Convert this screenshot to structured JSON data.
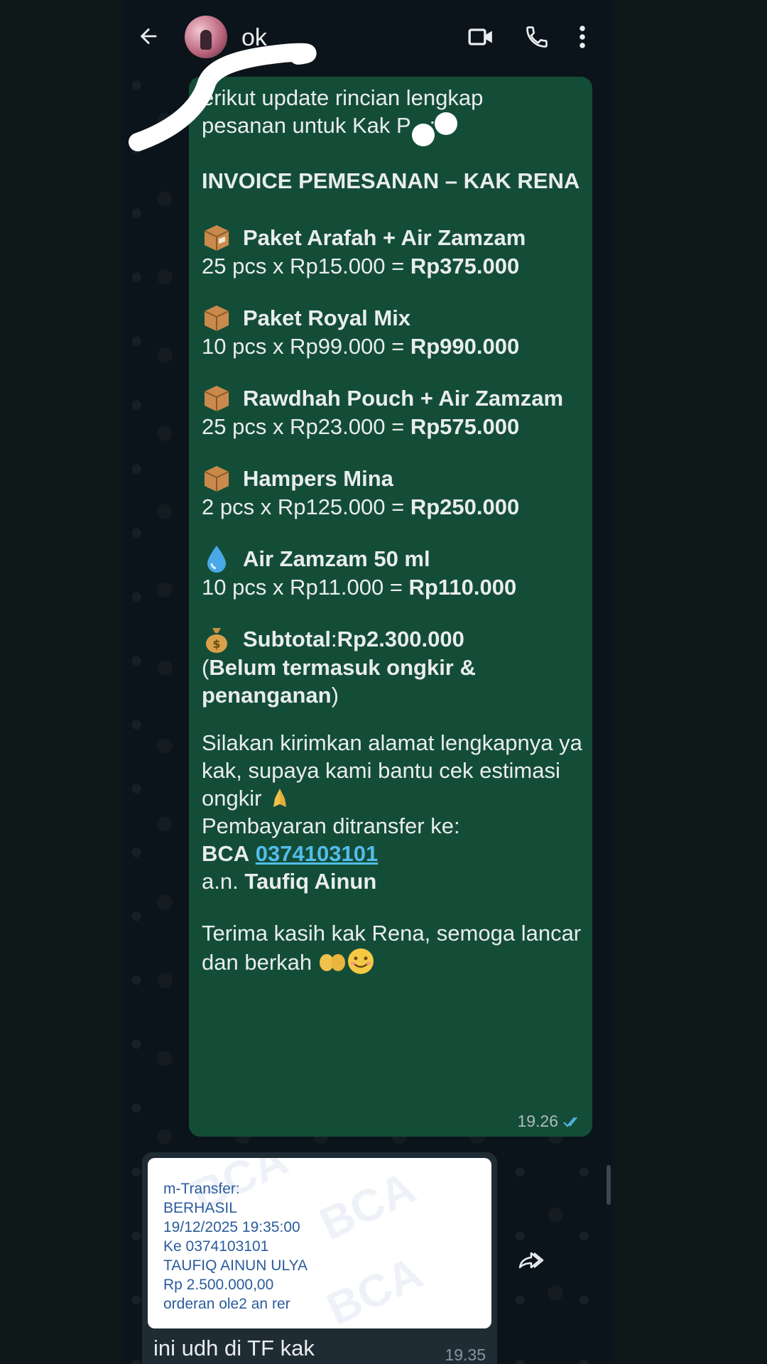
{
  "header": {
    "contact_name": "                  ok",
    "back_icon": "arrow-left-icon",
    "video_icon": "video-camera-icon",
    "call_icon": "phone-icon",
    "menu_icon": "more-vertical-icon"
  },
  "message_out": {
    "intro_line1": "erikut update rincian lengkap",
    "intro_line2": "pesanan untuk Kak P",
    "intro_line2_end": ":",
    "invoice_title": "INVOICE PEMESANAN – KAK RENA",
    "items": [
      {
        "icon": "package-emoji",
        "name": "Paket Arafah + Air Zamzam",
        "calc": "25 pcs x Rp15.000 = ",
        "total": "Rp375.000"
      },
      {
        "icon": "package-emoji",
        "name": "Paket Royal Mix",
        "calc": "10 pcs x Rp99.000 = ",
        "total": "Rp990.000"
      },
      {
        "icon": "package-emoji",
        "name": "Rawdhah Pouch + Air Zamzam",
        "calc": "25 pcs x Rp23.000 = ",
        "total": "Rp575.000"
      },
      {
        "icon": "package-emoji",
        "name": "Hampers Mina",
        "calc": "2 pcs x Rp125.000 = ",
        "total": "Rp250.000"
      },
      {
        "icon": "droplet-emoji",
        "name": "Air Zamzam 50 ml",
        "calc": "10 pcs x Rp11.000 = ",
        "total": "Rp110.000"
      }
    ],
    "subtotal_label": "Subtotal",
    "subtotal_sep": ": ",
    "subtotal_value": "Rp2.300.000",
    "note_open": "(",
    "note_bold": "Belum termasuk ongkir & penanganan",
    "note_close": ")",
    "request_text": "Silakan kirimkan alamat lengkapnya ya kak, supaya kami bantu cek estimasi ongkir",
    "payment_label": "Pembayaran ditransfer ke:",
    "bank_name": "BCA",
    "bank_account": "0374103101",
    "account_holder_prefix": "a.n. ",
    "account_holder": "Taufiq Ainun",
    "closing_text": "Terima kasih kak Rena, semoga lancar dan berkah",
    "time": "19.26",
    "status_icon": "double-check-read-icon"
  },
  "message_in": {
    "receipt_watermark": "BCA",
    "receipt_lines": [
      "m-Transfer:",
      "BERHASIL",
      "19/12/2025 19:35:00",
      "Ke 0374103101",
      "TAUFIQ AINUN ULYA",
      "Rp 2.500.000,00",
      "orderan ole2 an rer"
    ],
    "caption": "ini udh di TF kak",
    "time": "19.35"
  },
  "forward_icon": "forward-icon",
  "colors": {
    "bubble_out": "#144d37",
    "bubble_in": "#1f2c34",
    "background": "#0b141a",
    "link": "#53bdeb",
    "receipt_text": "#2b5c9c"
  }
}
